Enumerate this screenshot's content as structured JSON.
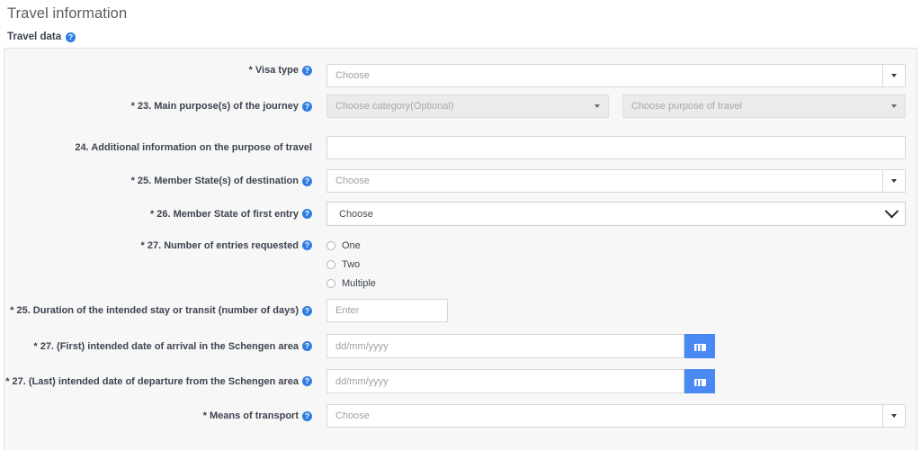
{
  "page": {
    "title": "Travel information",
    "section_label": "Travel data",
    "help_glyph": "?"
  },
  "colors": {
    "help_icon": "#2f7de1",
    "calendar_button": "#4a89f3",
    "panel_bg": "#f7f7f7",
    "panel_border": "#e2e2e2",
    "title_text": "#5b5b5b",
    "label_text": "#3d4450",
    "placeholder_text": "#a0a0a0"
  },
  "form": {
    "rows": [
      {
        "id": "visa-type",
        "label": "* Visa type",
        "has_help": true,
        "control": "combo",
        "placeholder": "Choose"
      },
      {
        "id": "main-purpose",
        "label": "* 23. Main purpose(s) of the journey",
        "has_help": true,
        "control": "dual-combo-disabled",
        "placeholder_left": "Choose category(Optional)",
        "placeholder_right": "Choose purpose of travel"
      },
      {
        "id": "additional-information",
        "label": "24. Additional information on the purpose of travel",
        "has_help": false,
        "control": "text",
        "placeholder": "",
        "value": ""
      },
      {
        "id": "member-states-destination",
        "label": "* 25. Member State(s) of destination",
        "has_help": true,
        "control": "combo",
        "placeholder": "Choose"
      },
      {
        "id": "member-state-first-entry",
        "label": "* 26. Member State of first entry",
        "has_help": true,
        "control": "select",
        "placeholder": "Choose"
      },
      {
        "id": "number-of-entries",
        "label": "* 27. Number of entries requested",
        "has_help": true,
        "control": "radio",
        "options": [
          "One",
          "Two",
          "Multiple"
        ],
        "selected": null
      },
      {
        "id": "duration-of-stay",
        "label": "* 25. Duration of the intended stay or transit (number of days)",
        "has_help": true,
        "control": "text-short",
        "placeholder": "Enter",
        "value": ""
      },
      {
        "id": "date-of-arrival",
        "label": "* 27. (First) intended date of arrival in the Schengen area",
        "has_help": true,
        "control": "date",
        "placeholder": "dd/mm/yyyy",
        "value": ""
      },
      {
        "id": "date-of-departure",
        "label": "* 27. (Last) intended date of departure from the Schengen area",
        "has_help": true,
        "control": "date",
        "placeholder": "dd/mm/yyyy",
        "value": ""
      },
      {
        "id": "means-of-transport",
        "label": "* Means of transport",
        "has_help": true,
        "control": "combo",
        "placeholder": "Choose"
      }
    ]
  }
}
